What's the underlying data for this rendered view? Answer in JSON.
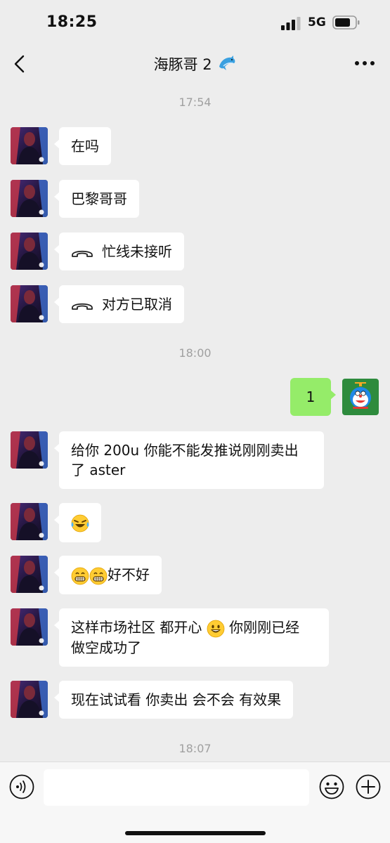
{
  "status": {
    "time": "18:25",
    "network": "5G"
  },
  "header": {
    "title": "海豚哥 2",
    "title_emoji": "dolphin"
  },
  "timestamps": [
    "17:54",
    "18:00",
    "18:07"
  ],
  "messages": [
    {
      "from": "other",
      "text": "在吗"
    },
    {
      "from": "other",
      "text": "巴黎哥哥"
    },
    {
      "from": "other",
      "type": "call",
      "text": "忙线未接听"
    },
    {
      "from": "other",
      "type": "call",
      "text": "对方已取消"
    },
    {
      "from": "me",
      "text": "1"
    },
    {
      "from": "other",
      "text_line1": "给你 200u 你能不能发推说刚刚卖出",
      "text_line2": "了 aster"
    },
    {
      "from": "other",
      "type": "emoji",
      "emoji": "laugh-cry"
    },
    {
      "from": "other",
      "emoji": "grin x2",
      "text": "好不好"
    },
    {
      "from": "other",
      "text_line1a": "这样市场社区 都开心 ",
      "emoji": "smile",
      "text_line1b": " 你刚刚已经",
      "text_line2": "做空成功了"
    },
    {
      "from": "other",
      "text": "现在试试看 你卖出 会不会 有效果"
    }
  ],
  "input_bar": {
    "placeholder": ""
  },
  "colors": {
    "background": "#ededed",
    "bubble_me": "#95ec69",
    "bubble_other": "#ffffff",
    "timestamp": "#a0a0a0"
  },
  "icons": [
    "signal-icon",
    "battery-icon",
    "back-icon",
    "more-icon",
    "voice-icon",
    "emoji-icon",
    "plus-icon",
    "phone-hangup-icon"
  ]
}
